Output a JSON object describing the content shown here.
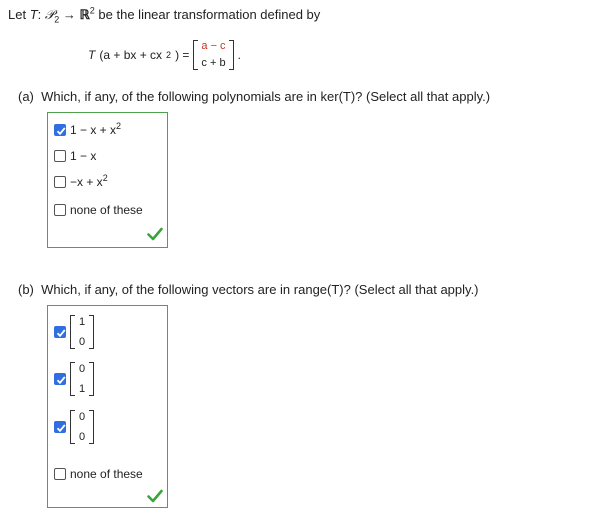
{
  "intro": {
    "prefix": "Let ",
    "T": "T",
    "colon": ": ",
    "P": "𝒫",
    "P_sub": "2",
    "arrow": " → ",
    "R": "ℝ",
    "R_sup": "2",
    "suffix": " be the linear transformation defined by"
  },
  "formula": {
    "lhs_open": "T",
    "lhs_args": "(a + bx + cx",
    "lhs_sup": "2",
    "lhs_close": ") =",
    "top": "a − c",
    "bottom": "c + b",
    "end": "."
  },
  "part_a": {
    "label": "(a)",
    "question": "Which, if any, of the following polynomials are in ker(T)? (Select all that apply.)",
    "options": [
      {
        "text": "1 − x + x",
        "sup": "2",
        "checked": true
      },
      {
        "text": "1 − x",
        "sup": "",
        "checked": false
      },
      {
        "text": "−x + x",
        "sup": "2",
        "checked": false
      },
      {
        "text": "none of these",
        "sup": "",
        "checked": false
      }
    ]
  },
  "part_b": {
    "label": "(b)",
    "question": "Which, if any, of the following vectors are in range(T)? (Select all that apply.)",
    "vectors": [
      {
        "top": "1",
        "bottom": "0",
        "checked": true
      },
      {
        "top": "0",
        "bottom": "1",
        "checked": true
      },
      {
        "top": "0",
        "bottom": "0",
        "checked": true
      }
    ],
    "none_label": "none of these",
    "none_checked": false
  },
  "colors": {
    "check_blue": "#2f6fe0",
    "panel_border": "#4ea24e",
    "correct_green": "#3aa53a"
  }
}
